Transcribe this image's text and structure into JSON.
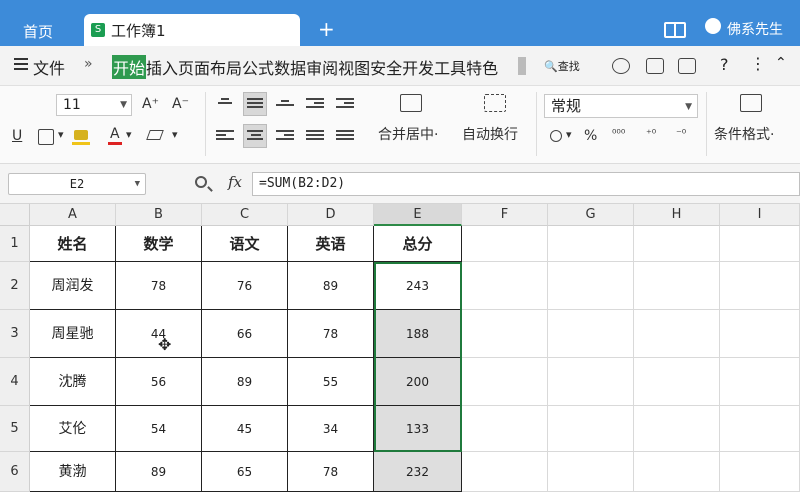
{
  "titlebar": {
    "home_tab": "首页",
    "doc_icon": "S",
    "doc_tab": "工作簿1",
    "new_tab": "+",
    "user": "佛系先生"
  },
  "menubar": {
    "file": "文件",
    "more_arrow": "»",
    "tabs": [
      "开始",
      "插入",
      "页面布局",
      "公式",
      "数据",
      "审阅",
      "视图",
      "安全",
      "开发工具",
      "特色"
    ],
    "search": "查找",
    "help": "?",
    "dots": "⋮",
    "collapse": "⌃"
  },
  "ribbon": {
    "font_size": "11",
    "font_grow": "A⁺",
    "font_shrink": "A⁻",
    "underline": "U",
    "merge_center": "合并居中",
    "wrap_text": "自动换行",
    "number_format": "常规",
    "percent": "%",
    "cond_format": "条件格式"
  },
  "formula_bar": {
    "name_box": "E2",
    "fx": "fx",
    "formula": "=SUM(B2:D2)"
  },
  "grid": {
    "columns": [
      "A",
      "B",
      "C",
      "D",
      "E",
      "F",
      "G",
      "H",
      "I"
    ],
    "rows": [
      "1",
      "2",
      "3",
      "4",
      "5",
      "6"
    ],
    "selected_column": "E",
    "header_row": [
      "姓名",
      "数学",
      "语文",
      "英语",
      "总分"
    ],
    "data": [
      [
        "周润发",
        "78",
        "76",
        "89",
        "243"
      ],
      [
        "周星驰",
        "44",
        "66",
        "78",
        "188"
      ],
      [
        "沈腾",
        "56",
        "89",
        "55",
        "200"
      ],
      [
        "艾伦",
        "54",
        "45",
        "34",
        "133"
      ],
      [
        "黄渤",
        "89",
        "65",
        "78",
        "232"
      ]
    ]
  },
  "colors": {
    "titlebar": "#3d8bd9",
    "active_tab": "#2f9a4f",
    "selection": "#1f7a3c"
  }
}
